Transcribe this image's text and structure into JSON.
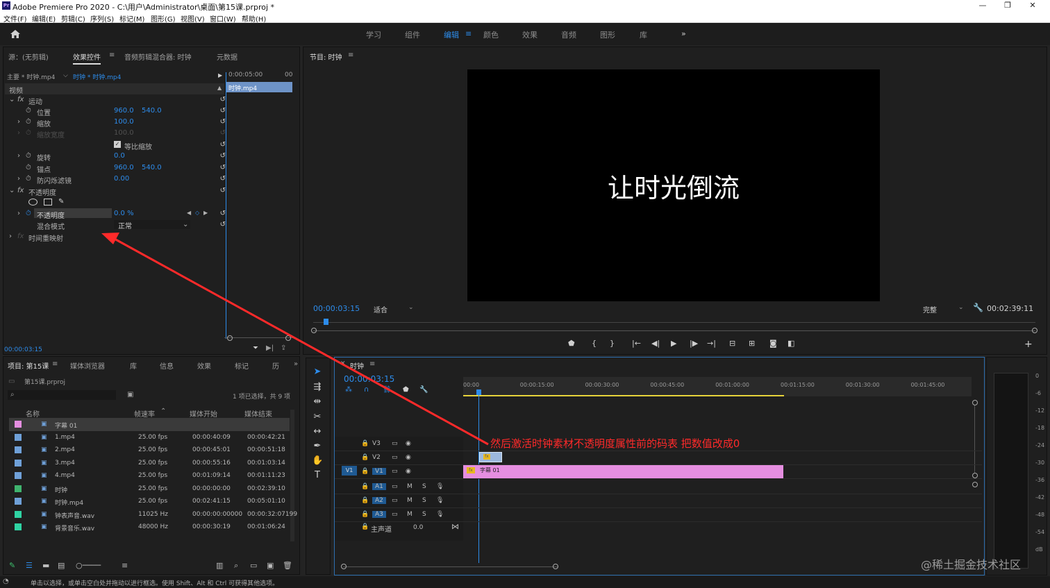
{
  "window": {
    "title": "Adobe Premiere Pro 2020 - C:\\用户\\Administrator\\桌面\\第15课.prproj *",
    "app_icon": "Pr",
    "minimize": "—",
    "maximize": "❐",
    "close": "✕"
  },
  "menu": [
    "文件(F)",
    "编辑(E)",
    "剪辑(C)",
    "序列(S)",
    "标记(M)",
    "图形(G)",
    "视图(V)",
    "窗口(W)",
    "帮助(H)"
  ],
  "workspaces": {
    "items": [
      "学习",
      "组件",
      "编辑",
      "颜色",
      "效果",
      "音频",
      "图形",
      "库"
    ],
    "active": "编辑",
    "more": "»"
  },
  "source_panel": {
    "tabs": [
      "源：(无剪辑)",
      "效果控件",
      "音频剪辑混合器: 时钟",
      "元数据"
    ],
    "active_tab": "效果控件",
    "master_clip": "主要 * 时钟.mp4",
    "sequence_clip": "时钟 * 时钟.mp4",
    "ruler_time": "0:00:05:00",
    "ruler_end": "00",
    "clip_bar": "时钟.mp4",
    "section_video": "视频",
    "motion": {
      "name": "运动",
      "position_label": "位置",
      "position_x": "960.0",
      "position_y": "540.0",
      "scale_label": "缩放",
      "scale": "100.0",
      "scale_width_label": "缩放宽度",
      "scale_width": "100.0",
      "uniform_scale_label": "等比缩放",
      "rotation_label": "旋转",
      "rotation": "0.0",
      "anchor_label": "锚点",
      "anchor_x": "960.0",
      "anchor_y": "540.0",
      "antiflicker_label": "防闪烁滤镜",
      "antiflicker": "0.00"
    },
    "opacity": {
      "name": "不透明度",
      "opacity_label": "不透明度",
      "opacity": "0.0 %",
      "blend_label": "混合模式",
      "blend": "正常"
    },
    "time_remap": "时间重映射",
    "current_time": "00:00:03:15"
  },
  "program": {
    "title": "节目: 时钟",
    "video_text": "让时光倒流",
    "timecode": "00:00:03:15",
    "fit": "适合",
    "quality": "完整",
    "duration": "00:02:39:11"
  },
  "project": {
    "tabs": [
      "项目: 第15课",
      "媒体浏览器",
      "库",
      "信息",
      "效果",
      "标记",
      "历"
    ],
    "file": "第15课.prproj",
    "selection_info": "1 项已选择，共 9 项",
    "columns": [
      "名称",
      "帧速率",
      "媒体开始",
      "媒体结束"
    ],
    "items": [
      {
        "name": "字幕 01",
        "fps": "",
        "start": "",
        "end": "",
        "color": "#e58ee0",
        "selected": true
      },
      {
        "name": "1.mp4",
        "fps": "25.00 fps",
        "start": "00:00:40:09",
        "end": "00:00:42:21",
        "color": "#6fa0d8"
      },
      {
        "name": "2.mp4",
        "fps": "25.00 fps",
        "start": "00:00:45:01",
        "end": "00:00:51:18",
        "color": "#6fa0d8"
      },
      {
        "name": "3.mp4",
        "fps": "25.00 fps",
        "start": "00:00:55:16",
        "end": "00:01:03:14",
        "color": "#6fa0d8"
      },
      {
        "name": "4.mp4",
        "fps": "25.00 fps",
        "start": "00:01:09:14",
        "end": "00:01:11:23",
        "color": "#6fa0d8"
      },
      {
        "name": "时钟",
        "fps": "25.00 fps",
        "start": "00:00:00:00",
        "end": "00:02:39:10",
        "color": "#3fb36e"
      },
      {
        "name": "时钟.mp4",
        "fps": "25.00 fps",
        "start": "00:02:41:15",
        "end": "00:05:01:10",
        "color": "#6fa0d8"
      },
      {
        "name": "钟表声音.wav",
        "fps": "11025 Hz",
        "start": "00:00:00:00000",
        "end": "00:00:32:07199",
        "color": "#2fd3a3"
      },
      {
        "name": "背景音乐.wav",
        "fps": "48000 Hz",
        "start": "00:00:30:19",
        "end": "00:01:06:24",
        "color": "#2fd3a3"
      }
    ]
  },
  "timeline": {
    "title": "时钟",
    "timecode": "00:00:03:15",
    "ruler": [
      "00:00",
      "00:00:15:00",
      "00:00:30:00",
      "00:00:45:00",
      "00:01:00:00",
      "00:01:15:00",
      "00:01:30:00",
      "00:01:45:00"
    ],
    "tracks_video": [
      "V3",
      "V2",
      "V1"
    ],
    "tracks_audio": [
      "A1",
      "A2",
      "A3"
    ],
    "master": "主声道",
    "master_value": "0.0",
    "source_patch": "V1",
    "clip_title": "字幕 01",
    "clip_fx": "fx",
    "mute": "M",
    "solo": "S"
  },
  "meter_scale": [
    "0",
    "-6",
    "-12",
    "-18",
    "-24",
    "-30",
    "-36",
    "-42",
    "-48",
    "-54",
    "dB"
  ],
  "annotation": "然后激活时钟素材不透明度属性前的码表 把数值改成0",
  "status_bar": "单击以选择，或单击空白处并拖动以进行框选。使用 Shift、Alt 和 Ctrl 可获得其他选项。",
  "watermark": "@稀土掘金技术社区",
  "colors": {
    "accent": "#2d8ceb",
    "annotation": "#ff2a2a",
    "v1_clip": "#e58ee0",
    "panel_bg": "#1f1f1f"
  }
}
